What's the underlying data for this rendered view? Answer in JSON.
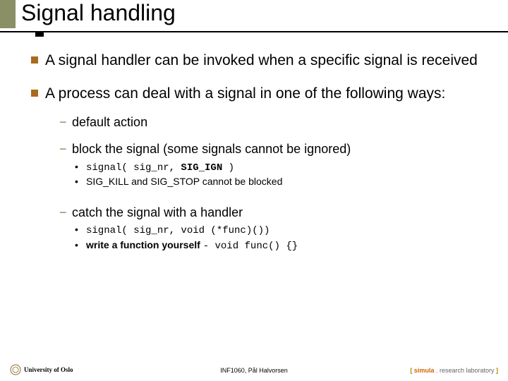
{
  "title": "Signal handling",
  "bullets": {
    "b1": "A signal handler can be invoked when a specific signal is received",
    "b2": "A process can deal with a signal in one of the following ways:",
    "b2_1": "default action",
    "b2_2": "block the signal (some signals cannot be ignored)",
    "b2_2_1a": "signal( sig_nr, ",
    "b2_2_1b": "SIG_IGN",
    "b2_2_1c": " )",
    "b2_2_2": "SIG_KILL and SIG_STOP cannot be blocked",
    "b2_3": "catch the signal with a handler",
    "b2_3_1": "signal( sig_nr, void (*func)())",
    "b2_3_2a": "write a function yourself ",
    "b2_3_2b": "- void func() {}"
  },
  "footer": {
    "left": "University of Oslo",
    "center": "INF1060, Pål Halvorsen",
    "right_bracket_open": "[ ",
    "right_simula": "simula",
    "right_dot": " . ",
    "right_lab": "research laboratory ",
    "right_bracket_close": "]"
  }
}
